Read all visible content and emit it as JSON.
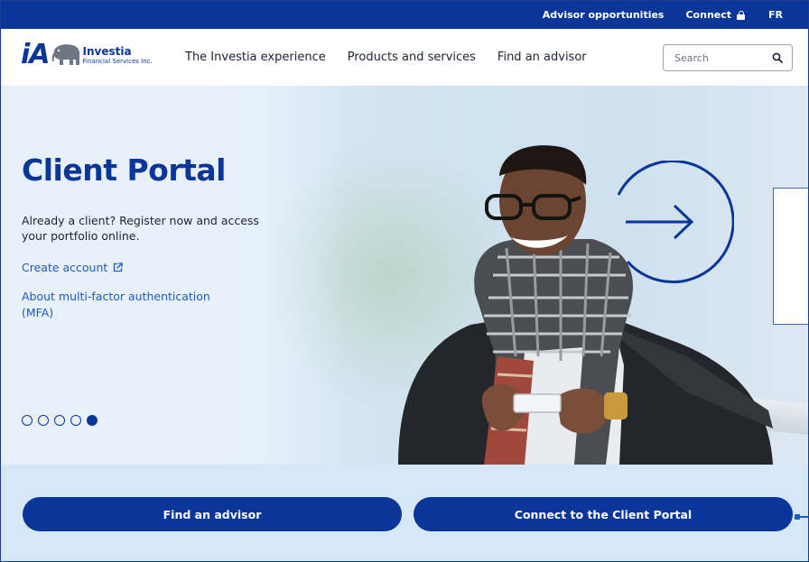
{
  "topbar": {
    "advisor_opportunities": "Advisor opportunities",
    "connect": "Connect",
    "language": "FR"
  },
  "header": {
    "logo_mark": "iA",
    "logo_name": "Investia",
    "logo_sub": "Financial Services Inc.",
    "nav": [
      {
        "label": "The Investia experience"
      },
      {
        "label": "Products and services"
      },
      {
        "label": "Find an advisor"
      }
    ],
    "search_placeholder": "Search"
  },
  "hero": {
    "title": "Client Portal",
    "lead": "Already a client? Register now and access your portfolio online.",
    "create_account": "Create account",
    "mfa_link": "About multi-factor authentication (MFA)",
    "carousel": {
      "total": 5,
      "active_index": 4
    }
  },
  "cta": {
    "find_advisor": "Find an advisor",
    "connect_portal": "Connect to the Client Portal"
  },
  "colors": {
    "brand": "#0a3699",
    "link": "#1d5bbf",
    "cta_band": "#d6e8f8"
  },
  "icons": {
    "lock": "lock-icon",
    "search": "search-icon",
    "external": "external-link-icon",
    "arrow": "arrow-right-icon"
  }
}
